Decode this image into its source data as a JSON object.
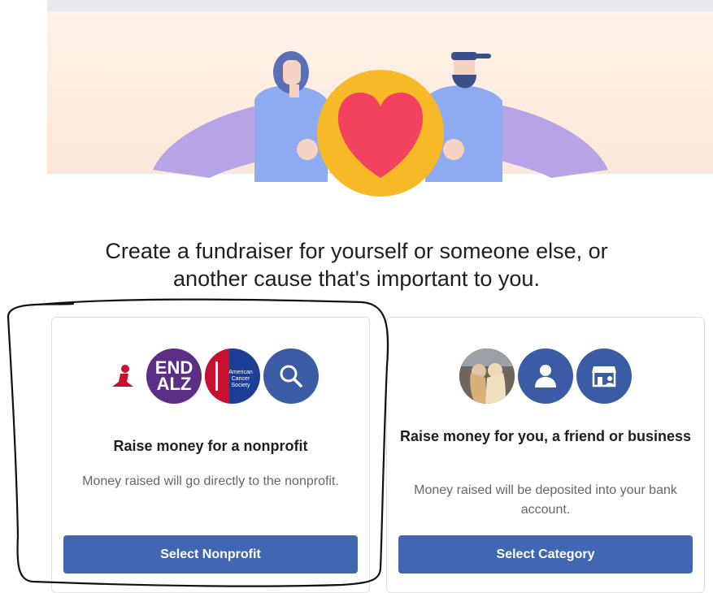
{
  "headline": {
    "line1": "Create a fundraiser for yourself or someone else, or",
    "line2": "another cause that's important to you."
  },
  "nonprofit_card": {
    "logos": {
      "end_alz_line1": "END",
      "end_alz_line2": "ALZ",
      "american_cancer_society": "American Cancer Society"
    },
    "title": "Raise money for a nonprofit",
    "description": "Money raised will go directly to the nonprofit.",
    "button_label": "Select Nonprofit"
  },
  "personal_card": {
    "title": "Raise money for you, a friend or business",
    "description": "Money raised will be deposited into your bank account.",
    "button_label": "Select Category"
  },
  "colors": {
    "button_blue": "#4267b2",
    "icon_blue": "#3b5ba5",
    "end_alz_purple": "#5c2e86",
    "acs_blue": "#1c3f95",
    "heart_red": "#f3425f",
    "coin_yellow": "#f7b928"
  },
  "icons": [
    "st-jude-logo",
    "end-alz-logo",
    "american-cancer-society-logo",
    "search-icon",
    "user-photo",
    "person-icon",
    "storefront-icon"
  ]
}
